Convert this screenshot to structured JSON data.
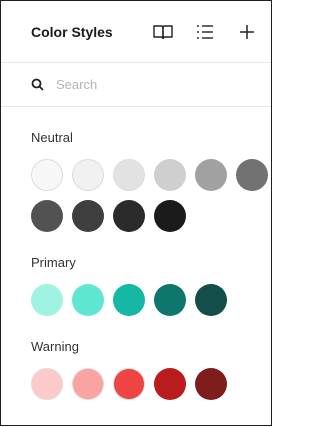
{
  "header": {
    "title": "Color Styles",
    "icons": [
      "book-icon",
      "list-icon",
      "plus-icon"
    ]
  },
  "search": {
    "placeholder": "Search",
    "value": ""
  },
  "groups": [
    {
      "label": "Neutral",
      "colors": [
        "#f7f7f7",
        "#f1f1f1",
        "#e2e2e2",
        "#cfcfcf",
        "#a1a1a1",
        "#727272",
        "#525252",
        "#3f3f3f",
        "#2b2b2b",
        "#1b1b1b"
      ]
    },
    {
      "label": "Primary",
      "colors": [
        "#9ff3e3",
        "#5ee6d3",
        "#14b8a5",
        "#0f766e",
        "#134e4a"
      ]
    },
    {
      "label": "Warning",
      "colors": [
        "#fec9c9",
        "#f9a3a3",
        "#ef4444",
        "#b91c1c",
        "#7f1d1d"
      ]
    }
  ]
}
